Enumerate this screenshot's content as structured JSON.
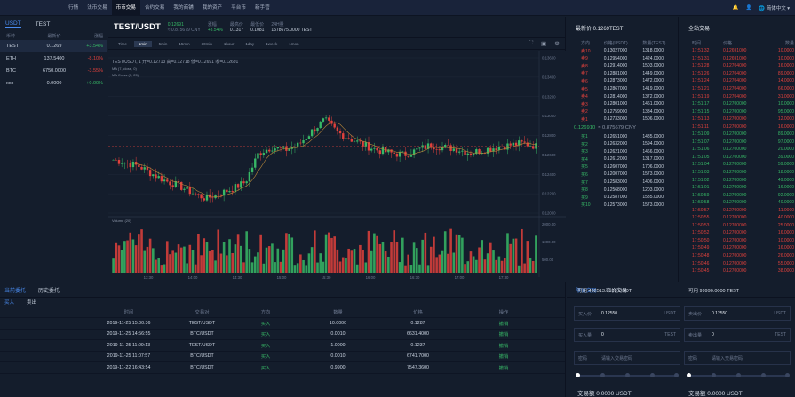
{
  "nav": {
    "logo": "",
    "items": [
      "行情",
      "法币交易",
      "币币交易",
      "合约交易",
      "我的商铺",
      "我的资产",
      "平台币",
      "新手营"
    ],
    "active": 2,
    "lang": "简体中文"
  },
  "market": {
    "tabs": [
      "USDT",
      "TEST"
    ],
    "headers": [
      "币种",
      "最新价",
      "涨幅"
    ],
    "rows": [
      {
        "coin": "TEST",
        "price": "0.1269",
        "change": "+3.54%",
        "dir": "up"
      },
      {
        "coin": "ETH",
        "price": "137.5400",
        "change": "-8.10%",
        "dir": "dn"
      },
      {
        "coin": "BTC",
        "price": "6750.0000",
        "change": "-3.55%",
        "dir": "dn"
      },
      {
        "coin": "xxx",
        "price": "0.0000",
        "change": "+0.00%",
        "dir": "up"
      }
    ]
  },
  "ticker": {
    "pair": "TEST/USDT",
    "last": "0.12691",
    "cny": "≈ 0.875679 CNY",
    "change": "+3.54%",
    "change_label": "涨幅",
    "high_label": "最高价",
    "high": "0.1317",
    "low_label": "最低价",
    "low": "0.1081",
    "vol_label": "24H量",
    "vol": "1578675.0000 TEST"
  },
  "toolbar": {
    "timeframes": [
      "Time",
      "1min",
      "5min",
      "15min",
      "30min",
      "1hour",
      "1day",
      "1week",
      "1mon"
    ],
    "active": 1
  },
  "chart": {
    "legend": "TEST/USDT, 1  开=0.12713 高=0.12718 低=0.12691 收=0.12691",
    "ma1": "MA (7, close, 0)",
    "ma2": "MA Cross (7, 25)",
    "vol_label": "Volume (20)",
    "price_ticks": [
      "0.13600",
      "0.13400",
      "0.13200",
      "0.13000",
      "0.12800",
      "0.12600",
      "0.12400",
      "0.12200",
      "0.12000"
    ],
    "vol_ticks": [
      "2000.00",
      "1000.00",
      "500.00"
    ],
    "time_ticks": [
      "13:30",
      "14:00",
      "14:30",
      "15:00",
      "15:30",
      "16:00",
      "16:30",
      "17:00",
      "17:30"
    ]
  },
  "chart_data": {
    "type": "candlestick",
    "series": [
      {
        "name": "TEST/USDT"
      }
    ],
    "close": [
      0.1255,
      0.1252,
      0.1248,
      0.124,
      0.1233,
      0.1228,
      0.1221,
      0.1215,
      0.122,
      0.1225,
      0.1232,
      0.1262,
      0.1268,
      0.1265,
      0.127,
      0.1284,
      0.1296,
      0.1283,
      0.1276,
      0.127,
      0.1265,
      0.1262,
      0.126,
      0.1265,
      0.127,
      0.1268,
      0.1266,
      0.1262,
      0.1265,
      0.1268,
      0.127,
      0.1272,
      0.1269
    ],
    "ylim": [
      0.12,
      0.136
    ]
  },
  "book": {
    "title": "最新价 0.1269TEST",
    "headers": [
      "方向",
      "价格(USDT)",
      "数量(TEST)"
    ],
    "asks": [
      [
        "卖10",
        "0.13027000",
        "1318.0000"
      ],
      [
        "卖9",
        "0.12954000",
        "1424.0000"
      ],
      [
        "卖8",
        "0.12914000",
        "1503.0000"
      ],
      [
        "卖7",
        "0.12881000",
        "1449.0000"
      ],
      [
        "卖6",
        "0.12873000",
        "1472.0000"
      ],
      [
        "卖5",
        "0.12867000",
        "1419.0000"
      ],
      [
        "卖4",
        "0.12814000",
        "1372.0000"
      ],
      [
        "卖3",
        "0.12801000",
        "1461.0000"
      ],
      [
        "卖2",
        "0.12759000",
        "1334.0000"
      ],
      [
        "卖1",
        "0.12733000",
        "1506.0000"
      ]
    ],
    "mid": "0.126910",
    "mid_cny": "≈ 0.875679 CNY",
    "bids": [
      [
        "买1",
        "0.12651000",
        "1485.0000"
      ],
      [
        "买2",
        "0.12632000",
        "1594.0000"
      ],
      [
        "买3",
        "0.12621000",
        "1466.0000"
      ],
      [
        "买4",
        "0.12612000",
        "1317.0000"
      ],
      [
        "买5",
        "0.12607000",
        "1706.0000"
      ],
      [
        "买6",
        "0.12007000",
        "1573.0000"
      ],
      [
        "买7",
        "0.12583000",
        "1406.0000"
      ],
      [
        "买8",
        "0.12568000",
        "1203.0000"
      ],
      [
        "买9",
        "0.12587000",
        "1535.0000"
      ],
      [
        "买10",
        "0.12573000",
        "1573.0000"
      ]
    ]
  },
  "trades": {
    "title": "全站交易",
    "headers": [
      "时间",
      "价格",
      "数量"
    ],
    "rows": [
      [
        "17:51:32",
        "0.12691000",
        "10.0000",
        "dn"
      ],
      [
        "17:51:31",
        "0.12691000",
        "10.0000",
        "dn"
      ],
      [
        "17:51:28",
        "0.12704000",
        "16.0000",
        "dn"
      ],
      [
        "17:51:26",
        "0.12704000",
        "89.0000",
        "dn"
      ],
      [
        "17:51:24",
        "0.12704000",
        "14.0000",
        "dn"
      ],
      [
        "17:51:21",
        "0.12704000",
        "66.0000",
        "dn"
      ],
      [
        "17:51:19",
        "0.12704000",
        "31.0000",
        "dn"
      ],
      [
        "17:51:17",
        "0.12700000",
        "10.0000",
        "up"
      ],
      [
        "17:51:15",
        "0.12700000",
        "95.0000",
        "up"
      ],
      [
        "17:51:13",
        "0.12700000",
        "12.0000",
        "dn"
      ],
      [
        "17:51:11",
        "0.12700000",
        "16.0000",
        "dn"
      ],
      [
        "17:51:09",
        "0.12700000",
        "89.0000",
        "up"
      ],
      [
        "17:51:07",
        "0.12700000",
        "97.0000",
        "up"
      ],
      [
        "17:51:06",
        "0.12700000",
        "20.0000",
        "up"
      ],
      [
        "17:51:05",
        "0.12700000",
        "39.0000",
        "up"
      ],
      [
        "17:51:04",
        "0.12700000",
        "59.0000",
        "up"
      ],
      [
        "17:51:03",
        "0.12700000",
        "18.0000",
        "up"
      ],
      [
        "17:51:02",
        "0.12700000",
        "49.0000",
        "up"
      ],
      [
        "17:51:01",
        "0.12700000",
        "16.0000",
        "up"
      ],
      [
        "17:50:59",
        "0.12700000",
        "92.0000",
        "up"
      ],
      [
        "17:50:58",
        "0.12700000",
        "40.0000",
        "up"
      ],
      [
        "17:50:57",
        "0.12700000",
        "11.0000",
        "dn"
      ],
      [
        "17:50:55",
        "0.12700000",
        "40.0000",
        "dn"
      ],
      [
        "17:50:53",
        "0.12700000",
        "25.0000",
        "dn"
      ],
      [
        "17:50:52",
        "0.12700000",
        "16.0000",
        "dn"
      ],
      [
        "17:50:50",
        "0.12700000",
        "10.0000",
        "dn"
      ],
      [
        "17:50:49",
        "0.12700000",
        "16.0000",
        "dn"
      ],
      [
        "17:50:48",
        "0.12700000",
        "26.0000",
        "dn"
      ],
      [
        "17:50:46",
        "0.12700000",
        "55.0000",
        "dn"
      ],
      [
        "17:50:45",
        "0.12700000",
        "38.0000",
        "dn"
      ]
    ]
  },
  "orders": {
    "tabs": [
      "当前委托",
      "历史委托"
    ],
    "sub": [
      "买入",
      "卖出"
    ],
    "headers": [
      "时间",
      "交易对",
      "方向",
      "数量",
      "价格",
      "操作"
    ],
    "rows": [
      [
        "2019-11-25 15:00:36",
        "TEST/USDT",
        "买入",
        "10.0000",
        "0.1287",
        "撤销"
      ],
      [
        "2019-11-25 14:56:55",
        "BTC/USDT",
        "买入",
        "0.0010",
        "6631.4000",
        "撤销"
      ],
      [
        "2019-11-25 11:09:13",
        "TEST/USDT",
        "买入",
        "1.0000",
        "0.1237",
        "撤销"
      ],
      [
        "2019-11-25 11:07:57",
        "BTC/USDT",
        "买入",
        "0.0010",
        "6741.7000",
        "撤销"
      ],
      [
        "2019-11-22 16:43:54",
        "BTC/USDT",
        "买入",
        "0.9900",
        "7547.3600",
        "撤销"
      ]
    ]
  },
  "form": {
    "tabs": [
      "限价交易",
      "市价交易"
    ],
    "buy": {
      "avail": "可用 492513.8183 USDT",
      "price_label": "买入价",
      "price": "0.12550",
      "price_unit": "USDT",
      "qty_label": "买入量",
      "qty": "0",
      "qty_unit": "TEST",
      "pwd_label": "密码",
      "pwd_ph": "请输入交易密码",
      "amount": "交易额 0.0000 USDT"
    },
    "sell": {
      "avail": "可用 99990.0000 TEST",
      "price_label": "卖出价",
      "price": "0.12550",
      "price_unit": "USDT",
      "qty_label": "卖出量",
      "qty": "0",
      "qty_unit": "TEST",
      "pwd_label": "密码",
      "pwd_ph": "请输入交易密码",
      "amount": "交易额 0.0000 USDT"
    }
  },
  "colors": {
    "up": "#37b866",
    "down": "#e0413c",
    "accent": "#4a8cf0"
  }
}
